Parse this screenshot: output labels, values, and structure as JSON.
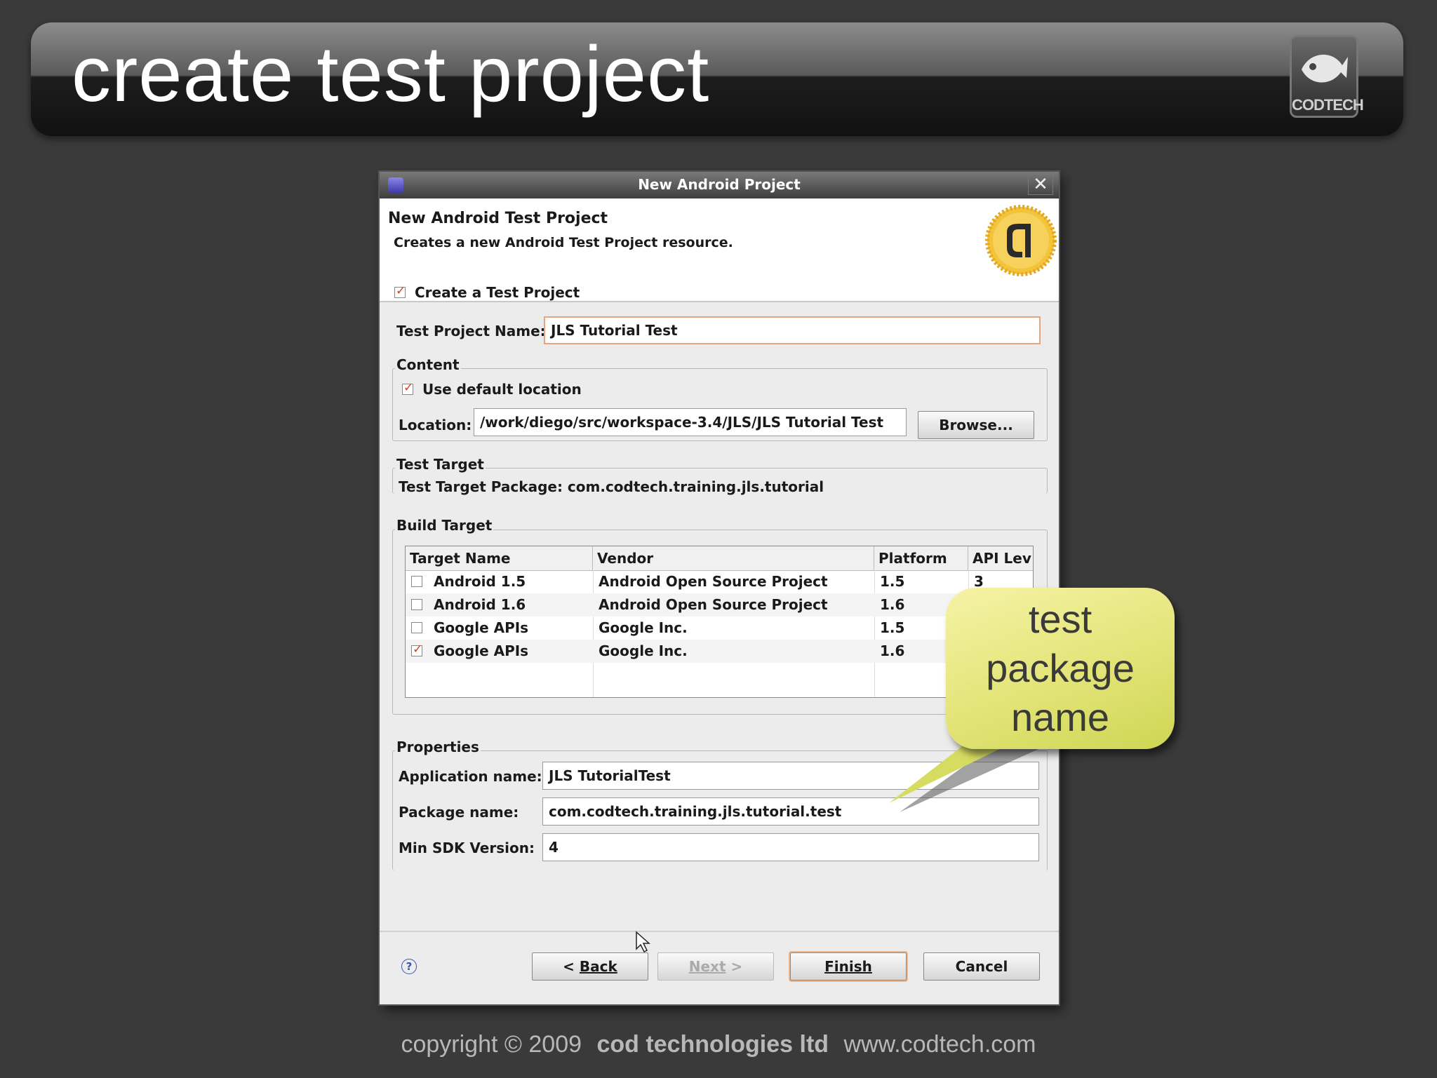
{
  "slide": {
    "title": "create test project",
    "logo_text": "CODTECH",
    "footer": {
      "copyright": "copyright © 2009",
      "company": "cod technologies ltd",
      "website": "www.codtech.com"
    }
  },
  "dialog": {
    "window_title": "New Android Project",
    "close_glyph": "✕",
    "heading": "New Android Test Project",
    "description": "Creates a new Android Test Project resource.",
    "create_test_project": {
      "label": "Create a Test Project",
      "checked": true
    },
    "test_project_name": {
      "label": "Test Project Name:",
      "value": "JLS Tutorial Test"
    },
    "content": {
      "title": "Content",
      "use_default_location": {
        "label": "Use default location",
        "checked": true
      },
      "location_label": "Location:",
      "location_value": "/work/diego/src/workspace-3.4/JLS/JLS Tutorial Test",
      "browse_label": "Browse..."
    },
    "test_target": {
      "title": "Test Target",
      "package_text": "Test Target Package: com.codtech.training.jls.tutorial"
    },
    "build_target": {
      "title": "Build Target",
      "columns": [
        "Target Name",
        "Vendor",
        "Platform",
        "API Lev"
      ],
      "rows": [
        {
          "name": "Android 1.5",
          "vendor": "Android Open Source Project",
          "platform": "1.5",
          "api": "3",
          "checked": false
        },
        {
          "name": "Android 1.6",
          "vendor": "Android Open Source Project",
          "platform": "1.6",
          "api": "",
          "checked": false
        },
        {
          "name": "Google APIs",
          "vendor": "Google Inc.",
          "platform": "1.5",
          "api": "",
          "checked": false
        },
        {
          "name": "Google APIs",
          "vendor": "Google Inc.",
          "platform": "1.6",
          "api": "",
          "checked": true
        }
      ]
    },
    "properties": {
      "title": "Properties",
      "app_name_label": "Application name:",
      "app_name_value": "JLS TutorialTest",
      "package_label": "Package name:",
      "package_value": "com.codtech.training.jls.tutorial.test",
      "min_sdk_label": "Min SDK Version:",
      "min_sdk_value": "4"
    },
    "buttons": {
      "help_glyph": "?",
      "back": "< Back",
      "next": "Next >",
      "finish": "Finish",
      "cancel": "Cancel"
    }
  },
  "callout": {
    "lines": [
      "test",
      "package",
      "name"
    ]
  },
  "colors": {
    "accent_check": "#d4421c",
    "callout_fill": "#e3e478",
    "focus_border": "#e8a47a"
  }
}
